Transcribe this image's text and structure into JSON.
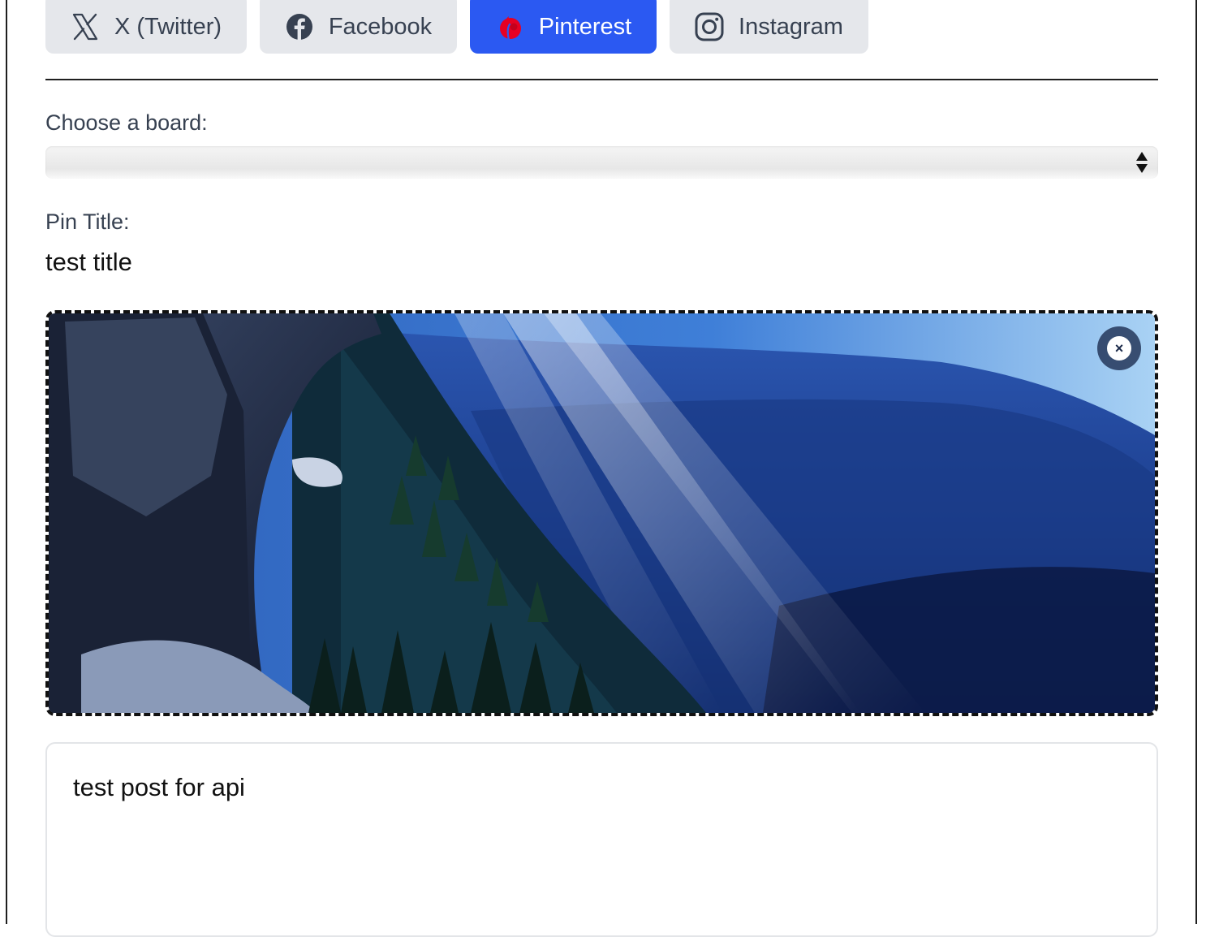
{
  "platform_tabs": [
    {
      "label": "X (Twitter)",
      "icon": "x-twitter-icon",
      "active": false
    },
    {
      "label": "Facebook",
      "icon": "facebook-icon",
      "active": false
    },
    {
      "label": "Pinterest",
      "icon": "pinterest-icon",
      "active": true
    },
    {
      "label": "Instagram",
      "icon": "instagram-icon",
      "active": false
    }
  ],
  "board": {
    "label": "Choose a board:",
    "selected": ""
  },
  "pin_title": {
    "label": "Pin Title:",
    "value": "test title"
  },
  "image": {
    "remove_symbol": "×"
  },
  "post": {
    "text": "test post for api"
  },
  "colors": {
    "active_tab": "#2b59f2",
    "inactive_tab": "#e5e7eb",
    "pinterest_brand": "#e60023"
  }
}
